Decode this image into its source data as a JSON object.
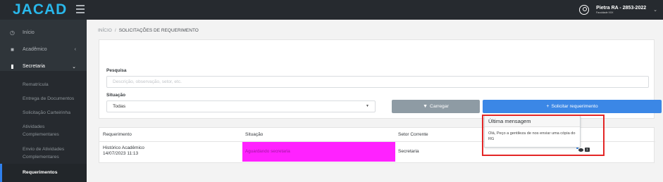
{
  "header": {
    "logo": "JACAD",
    "user_name": "Pietra RA - 2853-2022",
    "user_subtitle": "Faculdade XXX"
  },
  "sidebar": {
    "items": [
      {
        "label": "Início",
        "icon": "clock-icon"
      },
      {
        "label": "Acadêmico",
        "icon": "briefcase-icon"
      },
      {
        "label": "Secretaria",
        "icon": "document-icon"
      }
    ],
    "submenu": [
      "Rematrícula",
      "Entrega de Documentos",
      "Solicitação Carteirinha",
      "Atividades Complementares",
      "Envio de Atividades Complementares",
      "Requerimentos"
    ]
  },
  "breadcrumb": {
    "home": "INÍCIO",
    "separator": "/",
    "current": "SOLICITAÇÕES DE REQUERIMENTO"
  },
  "filters": {
    "search_label": "Pesquisa",
    "search_placeholder": "Descrição, observação, setor, etc.",
    "situation_label": "Situação",
    "situation_value": "Todas",
    "load_button": "Carregar",
    "request_button": "Solicitar requerimento"
  },
  "table": {
    "columns": [
      "Requerimento",
      "Situação",
      "Setor Corrente"
    ],
    "rows": [
      {
        "requerimento": "Histórico Acadêmico",
        "date": "14/07/2023 11:13",
        "situacao": "Aguardando secretaria",
        "setor": "Secretaria",
        "message_count": "1"
      }
    ]
  },
  "popover": {
    "title": "Última mensagem",
    "body": "Olá, Peço a gentileza de nos enviar uma cópia do RG"
  },
  "colors": {
    "accent": "#3b87e6",
    "status_highlight": "#ff22ff",
    "annotation": "#e32626"
  }
}
